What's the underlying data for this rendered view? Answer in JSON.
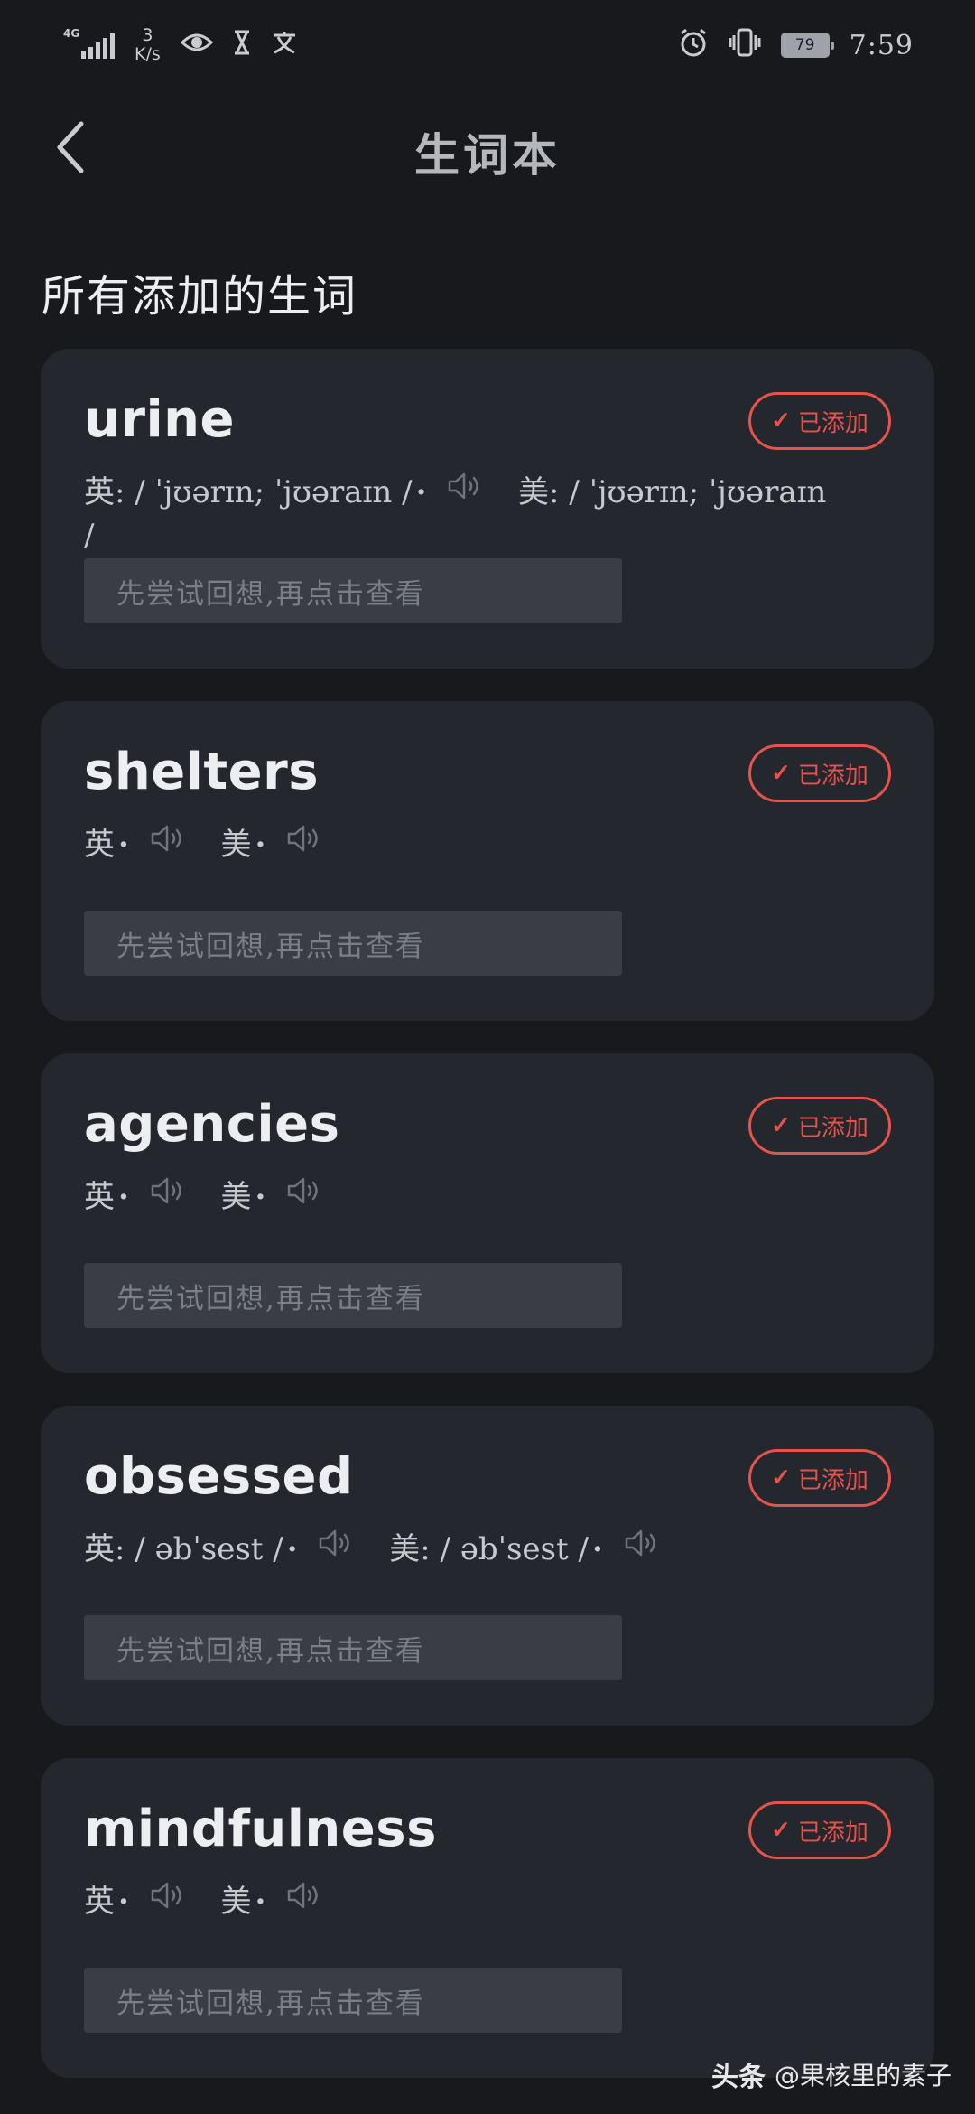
{
  "status_bar": {
    "network": "4G",
    "speed_value": "3",
    "speed_unit": "K/s",
    "battery": "79",
    "time": "7:59"
  },
  "header": {
    "title": "生词本"
  },
  "section_title": "所有添加的生词",
  "words": [
    {
      "word": "urine",
      "badge": "已添加",
      "uk_label": "英:",
      "uk_phonetic": "/ ˈjʊərɪn; ˈjʊəraɪn /",
      "us_label": "美:",
      "us_phonetic": "/ ˈjʊərɪn; ˈjʊəraɪn /",
      "reveal_placeholder": "先尝试回想,再点击查看"
    },
    {
      "word": "shelters",
      "badge": "已添加",
      "uk_label": "英",
      "uk_phonetic": "",
      "us_label": "美",
      "us_phonetic": "",
      "reveal_placeholder": "先尝试回想,再点击查看"
    },
    {
      "word": "agencies",
      "badge": "已添加",
      "uk_label": "英",
      "uk_phonetic": "",
      "us_label": "美",
      "us_phonetic": "",
      "reveal_placeholder": "先尝试回想,再点击查看"
    },
    {
      "word": "obsessed",
      "badge": "已添加",
      "uk_label": "英:",
      "uk_phonetic": "/ əbˈsest /",
      "us_label": "美:",
      "us_phonetic": "/ əbˈsest /",
      "reveal_placeholder": "先尝试回想,再点击查看"
    },
    {
      "word": "mindfulness",
      "badge": "已添加",
      "uk_label": "英",
      "uk_phonetic": "",
      "us_label": "美",
      "us_phonetic": "",
      "reveal_placeholder": "先尝试回想,再点击查看"
    }
  ],
  "watermark": {
    "logo": "头条",
    "handle": "@果核里的素子"
  },
  "colors": {
    "background": "#17191d",
    "card": "#24272e",
    "accent_red": "#e5534b",
    "reveal_box": "#3a3d45"
  }
}
